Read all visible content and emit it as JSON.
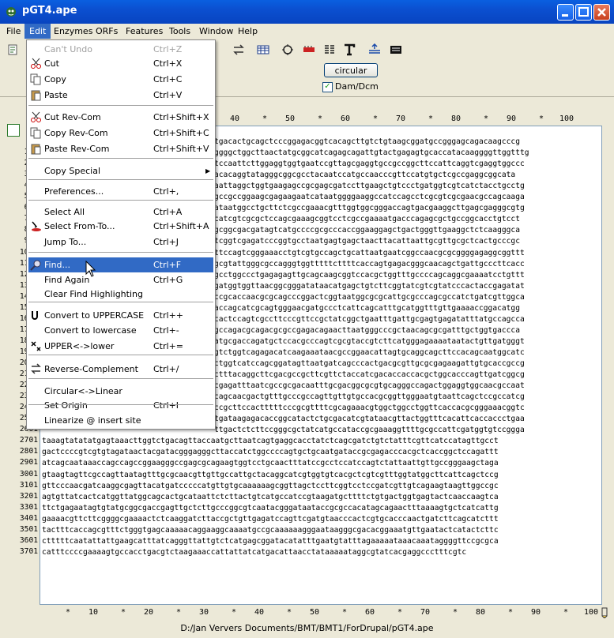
{
  "window": {
    "title": "pGT4.ape"
  },
  "menubar": [
    "File",
    "Edit",
    "Enzymes",
    "ORFs",
    "Features",
    "Tools",
    "Window",
    "Help"
  ],
  "options": {
    "circular_label": "circular",
    "damdcm_label": "Dam/Dcm"
  },
  "ruler_top": [
    "*",
    "40",
    "*",
    "50",
    "*",
    "60",
    "*",
    "70",
    "*",
    "80",
    "*",
    "90",
    "*",
    "100"
  ],
  "ruler_bottom": [
    "*",
    "10",
    "*",
    "20",
    "*",
    "30",
    "*",
    "40",
    "*",
    "50",
    "*",
    "60",
    "*",
    "70",
    "*",
    "80",
    "*",
    "90",
    "*",
    "100"
  ],
  "edit_menu": [
    {
      "label": "Can't Undo",
      "shortcut": "Ctrl+Z",
      "disabled": true
    },
    {
      "label": "Cut",
      "shortcut": "Ctrl+X",
      "icon": "scissors-icon"
    },
    {
      "label": "Copy",
      "shortcut": "Ctrl+C",
      "icon": "copy-icon"
    },
    {
      "label": "Paste",
      "shortcut": "Ctrl+V",
      "icon": "paste-icon"
    },
    {
      "label": "Cut Rev-Com",
      "shortcut": "Ctrl+Shift+X",
      "icon": "scissors-icon"
    },
    {
      "label": "Copy Rev-Com",
      "shortcut": "Ctrl+Shift+C",
      "icon": "copy-icon"
    },
    {
      "label": "Paste Rev-Com",
      "shortcut": "Ctrl+Shift+V",
      "icon": "paste-icon"
    },
    {
      "label": "Copy Special",
      "shortcut": ""
    },
    {
      "label": "Preferences...",
      "shortcut": "Ctrl+,"
    },
    {
      "label": "Select All",
      "shortcut": "Ctrl+A"
    },
    {
      "label": "Select From-To...",
      "shortcut": "Ctrl+Shift+A",
      "icon": "select-icon"
    },
    {
      "label": "Jump To...",
      "shortcut": "Ctrl+J"
    },
    {
      "label": "Find...",
      "shortcut": "Ctrl+F",
      "icon": "magnifier-icon",
      "highlighted": true
    },
    {
      "label": "Find Again",
      "shortcut": "Ctrl+G"
    },
    {
      "label": "Clear Find Highlighting",
      "shortcut": ""
    },
    {
      "label": "Convert to UPPERCASE",
      "shortcut": "Ctrl++",
      "icon": "uppercase-icon"
    },
    {
      "label": "Convert to lowercase",
      "shortcut": "Ctrl+-"
    },
    {
      "label": "UPPER<->lower",
      "shortcut": "Ctrl+=",
      "icon": "toggle-case-icon"
    },
    {
      "label": "Reverse-Complement",
      "shortcut": "Ctrl+/",
      "icon": "revcom-icon"
    },
    {
      "label": "Circular<->Linear",
      "shortcut": ""
    },
    {
      "label": "Set Origin",
      "shortcut": "Ctrl+I"
    },
    {
      "label": "Linearize @ insert site",
      "shortcut": ""
    }
  ],
  "seq_rows": [
    {
      "n": "1",
      "s": "tgacactgcagctcccggagacggtcacagcttgtctgtaagcggatgccgggagcagacaagcccg"
    },
    {
      "n": "101",
      "s": "ggggctggcttaactatgcggcatcagagcagattgtactgagagtgcaccatacaaggggttggtttg"
    },
    {
      "n": "201",
      "s": "tccaattcttggaggtggtgaatccgttagcgaggtgccgccggcttccattcaggtcgaggtggccc"
    },
    {
      "n": "301",
      "s": "acacaggtatagggcggcgcctacaatccatgccaacccgttccatgtgctcgccgaggcggcata"
    },
    {
      "n": "401",
      "s": "aattaggctggtgaagagccgcgagcgatccttgaagctgtccctgatggtcgtcatctacctgcctg"
    },
    {
      "n": "501",
      "s": "gccgccggaagcgagaagaatcataatggggaaggccatccagcctcgcgtcgcgaacgccagcaaga"
    },
    {
      "n": "601",
      "s": "ataatggcctgcttctcgccgaaacgtttggtggcgggaccagtgacgaaggcttgagcgagggcgtg"
    },
    {
      "n": "701",
      "s": "catcgtcgcgctccagcgaaagcggtcctcgccgaaaatgacccagagcgctgccggcacctgtcct"
    },
    {
      "n": "801",
      "s": "gcggcgacgatagtcatgccccgcgcccaccggaaggagctgactgggttgaaggctctcaagggca"
    },
    {
      "n": "901",
      "s": "tcggtcgagatcccggtgcctaatgagtgagctaacttacattaattgcgttgcgctcactgcccgc"
    },
    {
      "n": "1001",
      "s": "ttccagtcgggaaacctgtcgtgccagctgcattaatgaatcggccaacgcgcggggagaggcggttt"
    },
    {
      "n": "1101",
      "s": "gcgtattgggcgccagggtggtttttcttttcaccagtgagacgggcaacagctgattgcccttcacc"
    },
    {
      "n": "1201",
      "s": "gcctggccctgagagagttgcagcaagcggtccacgctggtttgccccagcaggcgaaaatcctgttt"
    },
    {
      "n": "1301",
      "s": "gatggtggttaacggcgggatataacatgagctgtcttcggtatcgtcgtatcccactaccgagatat"
    },
    {
      "n": "1401",
      "s": "ccgcaccaacgcgcagcccggactcggtaatggcgcgcattgcgcccagcgccatctgatcgttggca"
    },
    {
      "n": "1501",
      "s": "accagcatcgcagtgggaacgatgccctcattcagcatttgcatggtttgttgaaaaccggacatgg"
    },
    {
      "n": "1601",
      "s": "cactccagtcgccttcccgttccgctatcggctgaatttgattgcgagtgagatatttatgccagcca"
    },
    {
      "n": "1701",
      "s": "gccagacgcagacgcgccgagacagaacttaatgggcccgctaacagcgcgatttgctggtgaccca"
    },
    {
      "n": "1801",
      "s": "atgcgaccagatgctccacgcccagtcgcgtaccgtcttcatgggagaaaataatactgttgatgggt"
    },
    {
      "n": "1901",
      "s": "gtctggtcagagacatcaagaaataacgccggaacattagtgcaggcagcttccacagcaatggcatc"
    },
    {
      "n": "2001",
      "s": "ctggtcatccagcggatagttaatgatcagcccactgacgcgttgcgcgagaagattgtgcaccgccg"
    },
    {
      "n": "2101",
      "s": "ctttacaggcttcgacgccgcttcgttctaccatcgacaccaccacgctggcacccagttgatcggcg"
    },
    {
      "n": "2201",
      "s": "cgagatttaatcgccgcgacaatttgcgacggcgcgtgcagggccagactggaggtggcaacgccaat"
    },
    {
      "n": "2301",
      "s": "cagcaacgactgtttgcccgccagttgttgtgccacgcggttgggaatgtaattcagctccgccatcg"
    },
    {
      "n": "2401",
      "s": "ccgcttccactttttcccgcgttttcgcagaaacgtggctggcctggttcaccacgcgggaaacggtc"
    },
    {
      "n": "2501",
      "s": "tgataagagacaccggcatactctgcgacatcgtataacgttactggtttcacattcaccaccctgaa"
    },
    {
      "n": "2601",
      "s": "ttgactctcttccgggcgctatcatgccataccgcgaaaggttttgcgccattcgatggtgtccggga"
    },
    {
      "n": "2701",
      "s": "taaagtatatatgagtaaacttggtctgacagttaccaatgcttaatcagtgaggcacctatctcagcgatctgtctatttcgttcatccatagttgcct"
    },
    {
      "n": "2801",
      "s": "gactccccgtcgtgtagataactacgatacgggagggcttaccatctggccccagtgctgcaatgataccgcgagacccacgctcaccggctccagattt"
    },
    {
      "n": "2901",
      "s": "atcagcaataaaccagccagccggaagggccgagcgcagaagtggtcctgcaactttatccgcctccatccagtctattaattgttgccgggaagctaga"
    },
    {
      "n": "3001",
      "s": "gtaagtagttcgccagttaatagtttgcgcaacgttgttgccattgctacaggcatcgtggtgtcacgctcgtcgtttggtatggcttcattcagctccg"
    },
    {
      "n": "3101",
      "s": "gttcccaacgatcaaggcgagttacatgatcccccatgttgtgcaaaaaagcggttagctccttcggtcctccgatcgttgtcagaagtaagttggccgc"
    },
    {
      "n": "3201",
      "s": "agtgttatcactcatggttatggcagcactgcataattctcttactgtcatgccatccgtaagatgcttttctgtgactggtgagtactcaaccaagtca"
    },
    {
      "n": "3301",
      "s": "ttctgagaatagtgtatgcggcgaccgagttgctcttgcccggcgtcaatacgggataataccgcgccacatagcagaactttaaaagtgctcatcattg"
    },
    {
      "n": "3401",
      "s": "gaaaacgttcttcggggcgaaaactctcaaggatcttaccgctgttgagatccagttcgatgtaacccactcgtgcacccaactgatcttcagcatcttt"
    },
    {
      "n": "3501",
      "s": "tactttcaccagcgtttctgggtgagcaaaaacaggaaggcaaaatgccgcaaaaaagggaataagggcgacacggaaatgttgaatactcatactcttc"
    },
    {
      "n": "3601",
      "s": "ctttttcaatattattgaagcatttatcagggttattgtctcatgagcggatacatatttgaatgtatttagaaaaataaacaaataggggttccgcgca"
    },
    {
      "n": "3701",
      "s": "catttccccgaaaagtgccacctgacgtctaagaaaccattattatcatgacattaacctataaaaataggcgtatcacgaggccctttcgtc"
    }
  ],
  "statusbar": "D:/Jan Ververs  Documents/BMT/BMT1/ForDrupal/pGT4.ape"
}
